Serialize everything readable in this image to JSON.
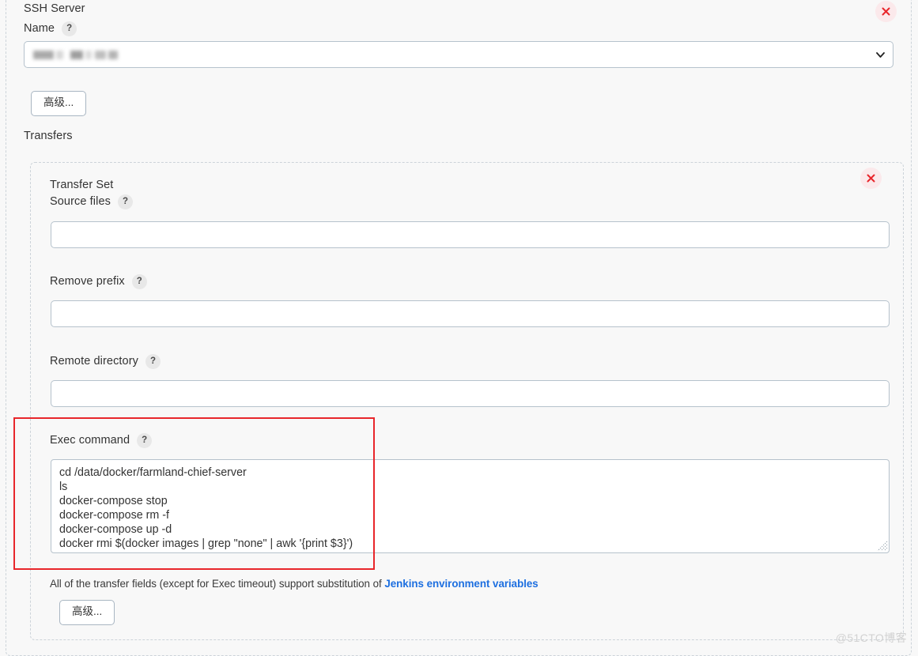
{
  "ssh_server": {
    "title_line1": "SSH Server",
    "title_line2": "Name",
    "help": "?",
    "close": "×",
    "selected_value_redacted": true,
    "advanced_label": "高级...",
    "transfers_label": "Transfers"
  },
  "transfer_set": {
    "title": "Transfer Set",
    "close": "×",
    "fields": [
      {
        "label": "Source files",
        "help": "?",
        "value": "",
        "placeholder": ""
      },
      {
        "label": "Remove prefix",
        "help": "?",
        "value": "",
        "placeholder": ""
      },
      {
        "label": "Remote directory",
        "help": "?",
        "value": "",
        "placeholder": ""
      }
    ],
    "exec_command": {
      "label": "Exec command",
      "help": "?",
      "value": "cd /data/docker/farmland-chief-server\nls\ndocker-compose stop\ndocker-compose rm -f\ndocker-compose up -d\ndocker rmi $(docker images | grep \"none\" | awk '{print $3}')"
    },
    "note_prefix": "All of the transfer fields (except for Exec timeout) support substitution of ",
    "note_link": "Jenkins environment variables",
    "advanced_label": "高级..."
  },
  "watermark": "@51CTO博客",
  "colors": {
    "accent_link": "#1d6fe0",
    "highlight_box": "#e8262b",
    "close_glyph": "#e8262b",
    "close_bg": "#fbe9eb",
    "panel_border": "#ccd3d9",
    "input_border": "#b6c2cc",
    "page_bg": "#f8f8f8"
  }
}
